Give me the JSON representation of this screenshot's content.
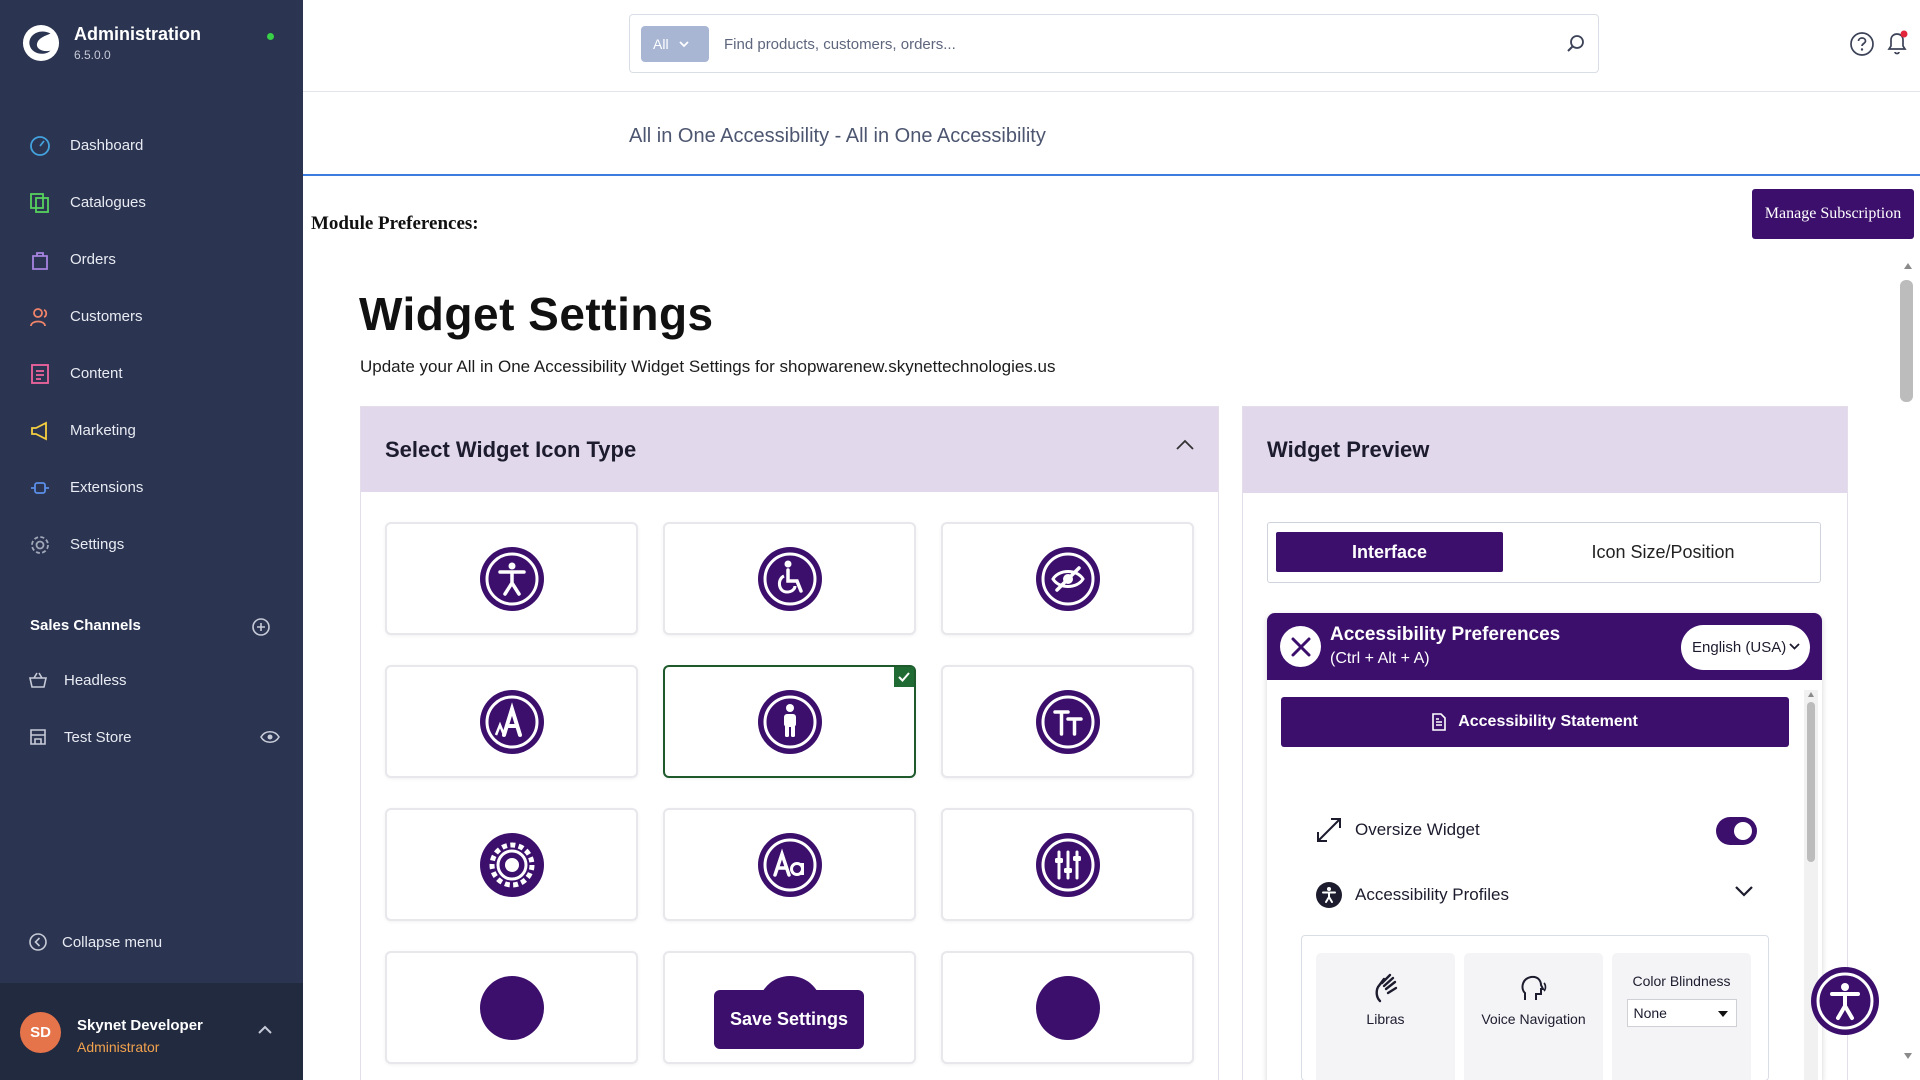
{
  "brand": {
    "title": "Administration",
    "version": "6.5.0.0"
  },
  "nav": [
    {
      "label": "Dashboard",
      "icon": "dashboard-icon",
      "color": "#43a2dd"
    },
    {
      "label": "Catalogues",
      "icon": "catalogue-icon",
      "color": "#57d35d"
    },
    {
      "label": "Orders",
      "icon": "orders-icon",
      "color": "#a784e0"
    },
    {
      "label": "Customers",
      "icon": "customers-icon",
      "color": "#f0846a"
    },
    {
      "label": "Content",
      "icon": "content-icon",
      "color": "#f1649d"
    },
    {
      "label": "Marketing",
      "icon": "marketing-icon",
      "color": "#f6cf3f"
    },
    {
      "label": "Extensions",
      "icon": "extensions-icon",
      "color": "#5b8ee8"
    },
    {
      "label": "Settings",
      "icon": "settings-icon",
      "color": "#a0a7b8"
    }
  ],
  "sales_channels": {
    "heading": "Sales Channels",
    "items": [
      {
        "label": "Headless",
        "icon": "basket-icon"
      },
      {
        "label": "Test Store",
        "icon": "storefront-icon"
      }
    ]
  },
  "collapse_menu": "Collapse menu",
  "user": {
    "initials": "SD",
    "name": "Skynet Developer",
    "role": "Administrator"
  },
  "search": {
    "scope": "All",
    "placeholder": "Find products, customers, orders..."
  },
  "page_header": {
    "title": "All in One Accessibility - All in One Accessibility"
  },
  "module_preferences": "Module Preferences:",
  "manage_subscription": "Manage Subscription",
  "widget_settings": {
    "title": "Widget Settings",
    "subtitle": "Update your All in One Accessibility Widget Settings for shopwarenew.skynettechnologies.us"
  },
  "icon_type_panel": {
    "title": "Select Widget Icon Type",
    "selected_index": 4,
    "icons": [
      "accessibility-person-icon",
      "wheelchair-icon",
      "eye-slash-icon",
      "letter-a-icon",
      "standing-person-icon",
      "text-size-icon",
      "gear-eye-icon",
      "aa-text-icon",
      "sliders-icon"
    ]
  },
  "save_settings": "Save Settings",
  "preview": {
    "title": "Widget Preview",
    "tabs": [
      "Interface",
      "Icon Size/Position"
    ],
    "active_tab": 0,
    "widget": {
      "title": "Accessibility Preferences",
      "shortcut": "(Ctrl + Alt + A)",
      "language": "English (USA)",
      "statement_button": "Accessibility Statement",
      "oversize_label": "Oversize Widget",
      "oversize_on": true,
      "profiles_label": "Accessibility Profiles",
      "features": [
        {
          "label": "Libras",
          "icon": "sign-language-icon"
        },
        {
          "label": "Voice Navigation",
          "icon": "voice-head-icon"
        }
      ],
      "color_blindness": {
        "label": "Color Blindness",
        "value": "None"
      }
    }
  },
  "colors": {
    "sidebar": "#2b3450",
    "brand_purple": "#3c0f6c",
    "panel_header": "#e2d8ec",
    "selected_border": "#1f5a2c"
  }
}
